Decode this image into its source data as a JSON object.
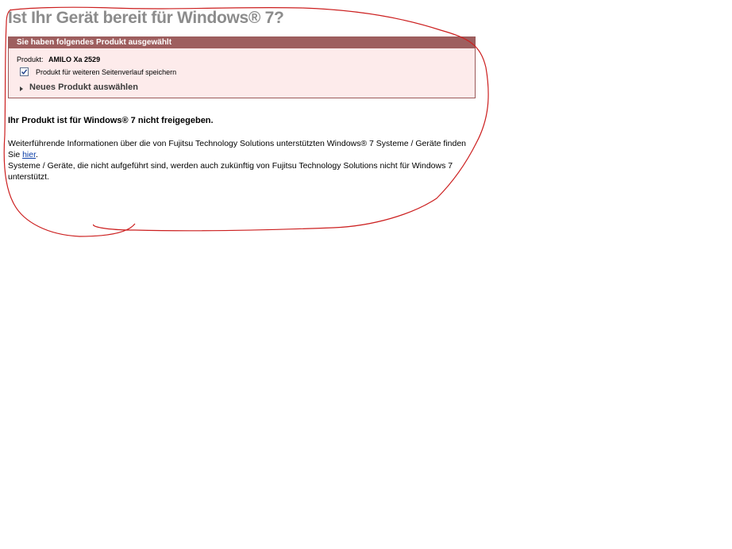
{
  "page": {
    "title": "Ist Ihr Gerät bereit für Windows® 7?"
  },
  "panel": {
    "header": "Sie haben folgendes Produkt ausgewählt",
    "product_label": "Produkt:",
    "product_value": "AMILO Xa 2529",
    "save_checkbox_label": "Produkt für weiteren Seitenverlauf speichern",
    "save_checked": true,
    "new_product_link": "Neues Produkt auswählen"
  },
  "result": {
    "status": "Ihr Produkt ist für Windows® 7 nicht freigegeben.",
    "info_line1": "Weiterführende Informationen über die von Fujitsu Technology Solutions unterstützten Windows® 7 Systeme / Geräte finden Sie ",
    "info_link": "hier",
    "info_line1_end": ".",
    "info_line2": "Systeme / Geräte, die nicht aufgeführt sind, werden auch zukünftig von Fujitsu Technology Solutions nicht für Windows 7 unterstützt."
  },
  "colors": {
    "panel_header_bg": "#9e5f5f",
    "panel_bg": "#fdebeb",
    "title_color": "#8c8c8c",
    "link_color": "#0b3ea8",
    "annotation_color": "#cc1f1f"
  },
  "icons": {
    "checkbox": "check-icon",
    "link_arrow": "triangle-right-icon"
  }
}
